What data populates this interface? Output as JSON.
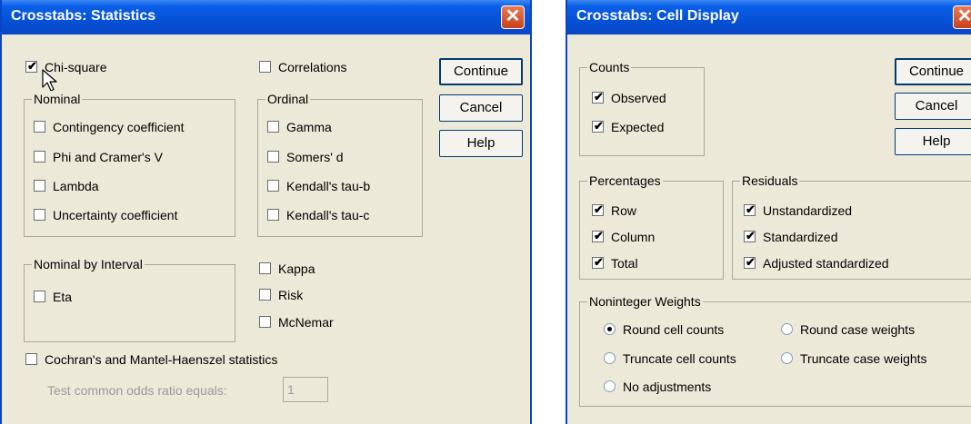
{
  "statistics_dialog": {
    "title": "Crosstabs: Statistics",
    "close_label": "✕",
    "chi_square": {
      "label": "Chi-square",
      "checked": true
    },
    "correlations": {
      "label": "Correlations",
      "checked": false
    },
    "nominal": {
      "title": "Nominal",
      "items": [
        {
          "label": "Contingency coefficient",
          "checked": false
        },
        {
          "label": "Phi and Cramer's V",
          "checked": false
        },
        {
          "label": "Lambda",
          "checked": false
        },
        {
          "label": "Uncertainty coefficient",
          "checked": false
        }
      ]
    },
    "ordinal": {
      "title": "Ordinal",
      "items": [
        {
          "label": "Gamma",
          "checked": false
        },
        {
          "label": "Somers' d",
          "checked": false
        },
        {
          "label": "Kendall's tau-b",
          "checked": false
        },
        {
          "label": "Kendall's tau-c",
          "checked": false
        }
      ]
    },
    "nominal_by_interval": {
      "title": "Nominal by Interval",
      "items": [
        {
          "label": "Eta",
          "checked": false
        }
      ]
    },
    "other": {
      "items": [
        {
          "label": "Kappa",
          "checked": false
        },
        {
          "label": "Risk",
          "checked": false
        },
        {
          "label": "McNemar",
          "checked": false
        }
      ]
    },
    "cmh": {
      "label": "Cochran's and Mantel-Haenszel statistics",
      "checked": false
    },
    "odds_ratio": {
      "label": "Test common odds ratio equals:",
      "value": "1"
    },
    "buttons": {
      "continue": "Continue",
      "cancel": "Cancel",
      "help": "Help"
    }
  },
  "cell_display_dialog": {
    "title": "Crosstabs: Cell Display",
    "close_label": "✕",
    "counts": {
      "title": "Counts",
      "items": [
        {
          "label": "Observed",
          "checked": true
        },
        {
          "label": "Expected",
          "checked": true
        }
      ]
    },
    "percentages": {
      "title": "Percentages",
      "items": [
        {
          "label": "Row",
          "checked": true
        },
        {
          "label": "Column",
          "checked": true
        },
        {
          "label": "Total",
          "checked": true
        }
      ]
    },
    "residuals": {
      "title": "Residuals",
      "items": [
        {
          "label": "Unstandardized",
          "checked": true
        },
        {
          "label": "Standardized",
          "checked": true
        },
        {
          "label": "Adjusted standardized",
          "checked": true
        }
      ]
    },
    "noninteger_weights": {
      "title": "Noninteger Weights",
      "selected": "Round cell counts",
      "options": [
        {
          "label": "Round cell counts",
          "selected": true
        },
        {
          "label": "Round case weights",
          "selected": false
        },
        {
          "label": "Truncate cell counts",
          "selected": false
        },
        {
          "label": "Truncate case weights",
          "selected": false
        },
        {
          "label": "No adjustments",
          "selected": false
        }
      ]
    },
    "buttons": {
      "continue": "Continue",
      "cancel": "Cancel",
      "help": "Help"
    }
  },
  "colors": {
    "titlebar": "#0651d6",
    "dialog_bg": "#ece9d8",
    "close_button": "#d5532d",
    "group_border": "#aca899",
    "disabled_text": "#9a9a9a"
  }
}
